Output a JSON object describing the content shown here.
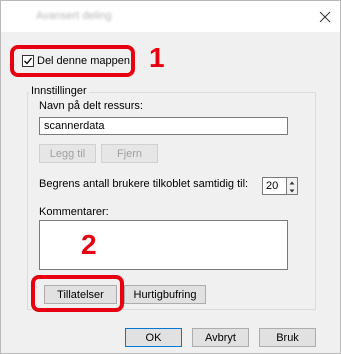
{
  "window": {
    "title": "Avansert deling",
    "close_glyph": "×"
  },
  "share": {
    "checkbox_label": "Del denne mappen",
    "checked": true
  },
  "settings": {
    "group_label": "Innstillinger",
    "share_name_label": "Navn på delt ressurs:",
    "share_name_value": "scannerdata",
    "add_label": "Legg til",
    "remove_label": "Fjern",
    "limit_label": "Begrens antall brukere tilkoblet samtidig til:",
    "limit_value": "20",
    "comments_label": "Kommentarer:",
    "permissions_label": "Tillatelser",
    "caching_label": "Hurtigbufring"
  },
  "footer": {
    "ok_label": "OK",
    "cancel_label": "Avbryt",
    "apply_label": "Bruk"
  },
  "annotations": {
    "step1": "1",
    "step2": "2",
    "color": "#e60012"
  }
}
